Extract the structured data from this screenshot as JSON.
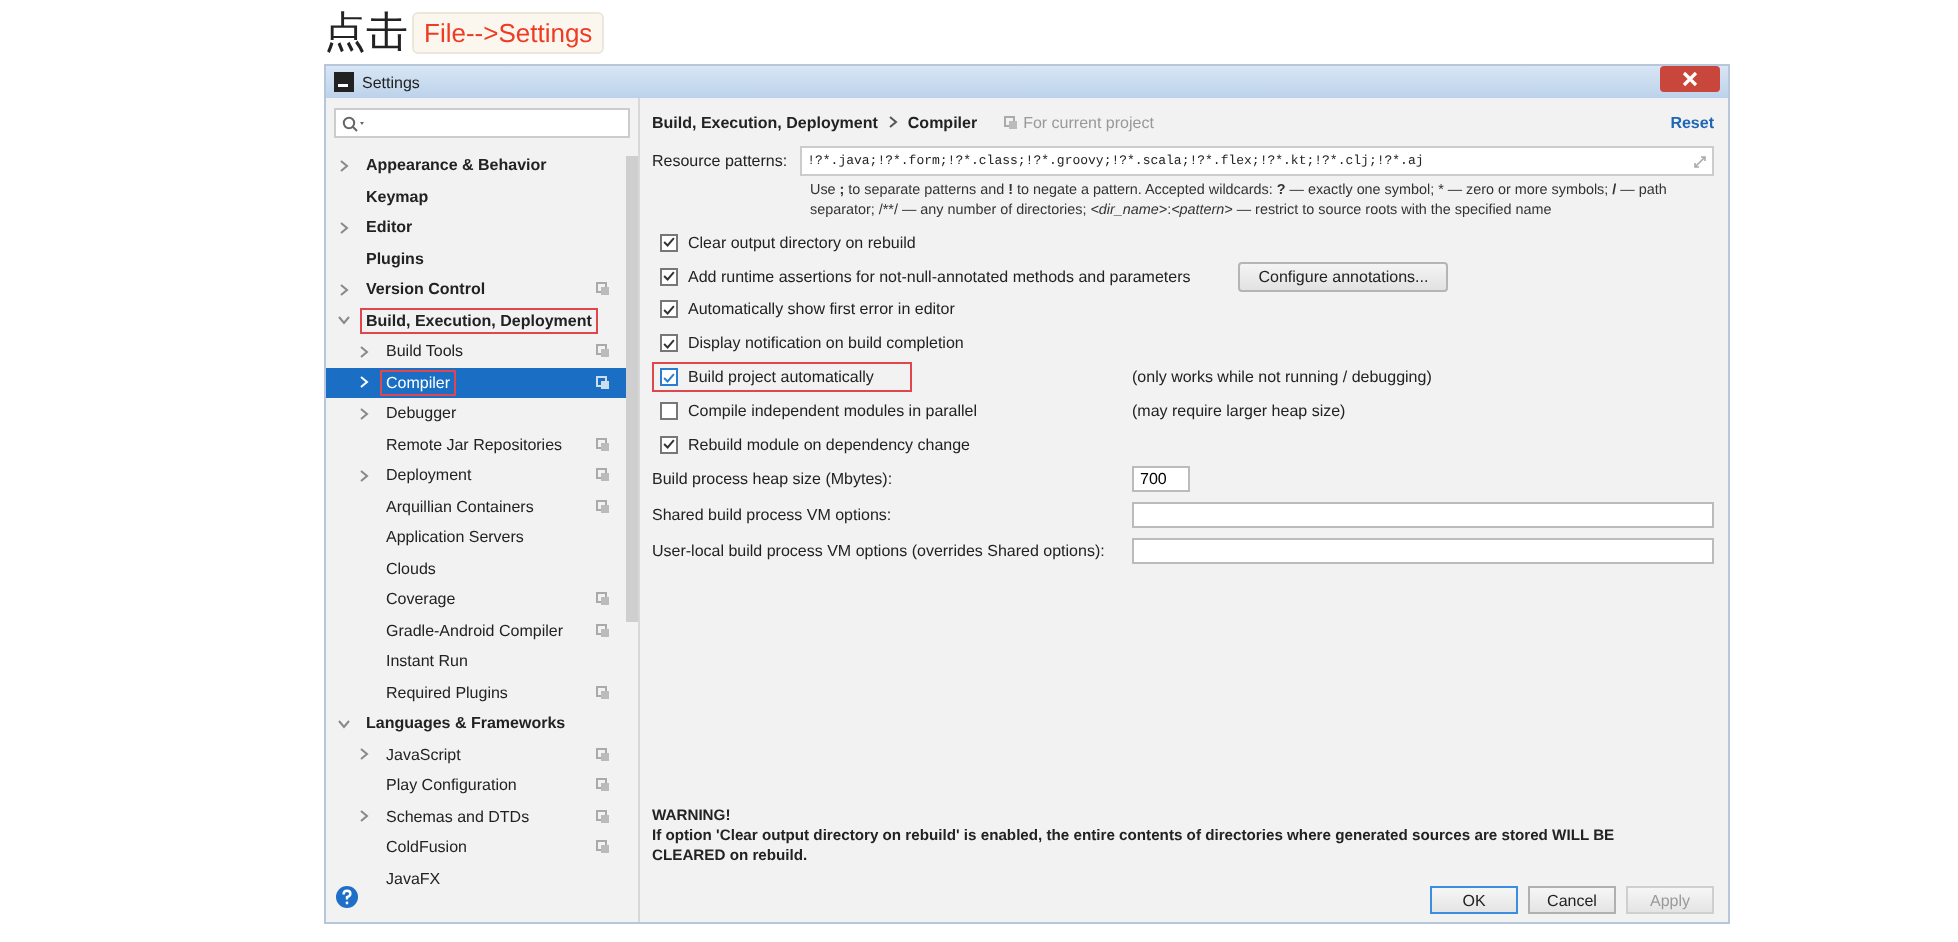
{
  "caption": {
    "prefix": "点击",
    "tag": "File-->Settings"
  },
  "window": {
    "title": "Settings"
  },
  "sidebar": {
    "items": [
      {
        "label": "Appearance & Behavior",
        "kind": "folder",
        "expanded": false,
        "selected": false,
        "project_scope": false,
        "highlighted": false
      },
      {
        "label": "Keymap",
        "kind": "leaf",
        "selected": false,
        "project_scope": false,
        "highlighted": false
      },
      {
        "label": "Editor",
        "kind": "folder",
        "expanded": false,
        "selected": false,
        "project_scope": false,
        "highlighted": false
      },
      {
        "label": "Plugins",
        "kind": "leaf",
        "selected": false,
        "project_scope": false,
        "highlighted": false
      },
      {
        "label": "Version Control",
        "kind": "folder",
        "expanded": false,
        "selected": false,
        "project_scope": true,
        "highlighted": false
      },
      {
        "label": "Build, Execution, Deployment",
        "kind": "folder",
        "expanded": true,
        "selected": false,
        "project_scope": false,
        "highlighted": true,
        "children": [
          {
            "label": "Build Tools",
            "kind": "folder",
            "expanded": false,
            "selected": false,
            "project_scope": true,
            "highlighted": false
          },
          {
            "label": "Compiler",
            "kind": "folder",
            "expanded": false,
            "selected": true,
            "project_scope": true,
            "highlighted": true
          },
          {
            "label": "Debugger",
            "kind": "folder",
            "expanded": false,
            "selected": false,
            "project_scope": false,
            "highlighted": false
          },
          {
            "label": "Remote Jar Repositories",
            "kind": "leaf",
            "selected": false,
            "project_scope": true,
            "highlighted": false
          },
          {
            "label": "Deployment",
            "kind": "folder",
            "expanded": false,
            "selected": false,
            "project_scope": true,
            "highlighted": false
          },
          {
            "label": "Arquillian Containers",
            "kind": "leaf",
            "selected": false,
            "project_scope": true,
            "highlighted": false
          },
          {
            "label": "Application Servers",
            "kind": "leaf",
            "selected": false,
            "project_scope": false,
            "highlighted": false
          },
          {
            "label": "Clouds",
            "kind": "leaf",
            "selected": false,
            "project_scope": false,
            "highlighted": false
          },
          {
            "label": "Coverage",
            "kind": "leaf",
            "selected": false,
            "project_scope": true,
            "highlighted": false
          },
          {
            "label": "Gradle-Android Compiler",
            "kind": "leaf",
            "selected": false,
            "project_scope": true,
            "highlighted": false
          },
          {
            "label": "Instant Run",
            "kind": "leaf",
            "selected": false,
            "project_scope": false,
            "highlighted": false
          },
          {
            "label": "Required Plugins",
            "kind": "leaf",
            "selected": false,
            "project_scope": true,
            "highlighted": false
          }
        ]
      },
      {
        "label": "Languages & Frameworks",
        "kind": "folder",
        "expanded": true,
        "selected": false,
        "project_scope": false,
        "highlighted": false,
        "children": [
          {
            "label": "JavaScript",
            "kind": "folder",
            "expanded": false,
            "selected": false,
            "project_scope": true,
            "highlighted": false
          },
          {
            "label": "Play Configuration",
            "kind": "leaf",
            "selected": false,
            "project_scope": true,
            "highlighted": false
          },
          {
            "label": "Schemas and DTDs",
            "kind": "folder",
            "expanded": false,
            "selected": false,
            "project_scope": true,
            "highlighted": false
          },
          {
            "label": "ColdFusion",
            "kind": "leaf",
            "selected": false,
            "project_scope": true,
            "highlighted": false
          },
          {
            "label": "JavaFX",
            "kind": "leaf",
            "selected": false,
            "project_scope": false,
            "highlighted": false
          }
        ]
      }
    ]
  },
  "breadcrumb": [
    "Build, Execution, Deployment",
    "Compiler"
  ],
  "scope_note": "For current project",
  "reset_link": "Reset",
  "resource_patterns": {
    "label": "Resource patterns:",
    "value": "!?*.java;!?*.form;!?*.class;!?*.groovy;!?*.scala;!?*.flex;!?*.kt;!?*.clj;!?*.aj",
    "help": "Use **;** to separate patterns and **!** to negate a pattern. Accepted wildcards: **?** — exactly one symbol; * — zero or more symbols; **/** — path separator; /**/ — any number of directories;  *<dir_name>*:*<pattern>* — restrict to source roots with the specified name"
  },
  "options": [
    {
      "label": "Clear output directory on rebuild",
      "checked": true,
      "highlighted": false
    },
    {
      "label": "Add runtime assertions for not-null-annotated methods and parameters",
      "checked": true,
      "highlighted": false,
      "button": "Configure annotations..."
    },
    {
      "label": "Automatically show first error in editor",
      "checked": true,
      "highlighted": false
    },
    {
      "label": "Display notification on build completion",
      "checked": true,
      "highlighted": false
    },
    {
      "label": "Build project automatically",
      "checked": true,
      "highlighted": true,
      "note": "(only works while not running / debugging)"
    },
    {
      "label": "Compile independent modules in parallel",
      "checked": false,
      "highlighted": false,
      "note": "(may require larger heap size)"
    },
    {
      "label": "Rebuild module on dependency change",
      "checked": true,
      "highlighted": false
    }
  ],
  "fields": [
    {
      "label": "Build process heap size (Mbytes):",
      "value": "700",
      "kind": "short"
    },
    {
      "label": "Shared build process VM options:",
      "kind": "wide"
    },
    {
      "label": "User-local build process VM options (overrides Shared options):",
      "kind": "wide"
    }
  ],
  "warning": {
    "title": "WARNING!",
    "text": "If option 'Clear output directory on rebuild' is enabled, the entire contents of directories where generated sources are stored WILL BE CLEARED on rebuild."
  },
  "buttons": [
    {
      "label": "OK",
      "default": true,
      "disabled": false
    },
    {
      "label": "Cancel",
      "default": false,
      "disabled": false
    },
    {
      "label": "Apply",
      "default": false,
      "disabled": true
    }
  ]
}
